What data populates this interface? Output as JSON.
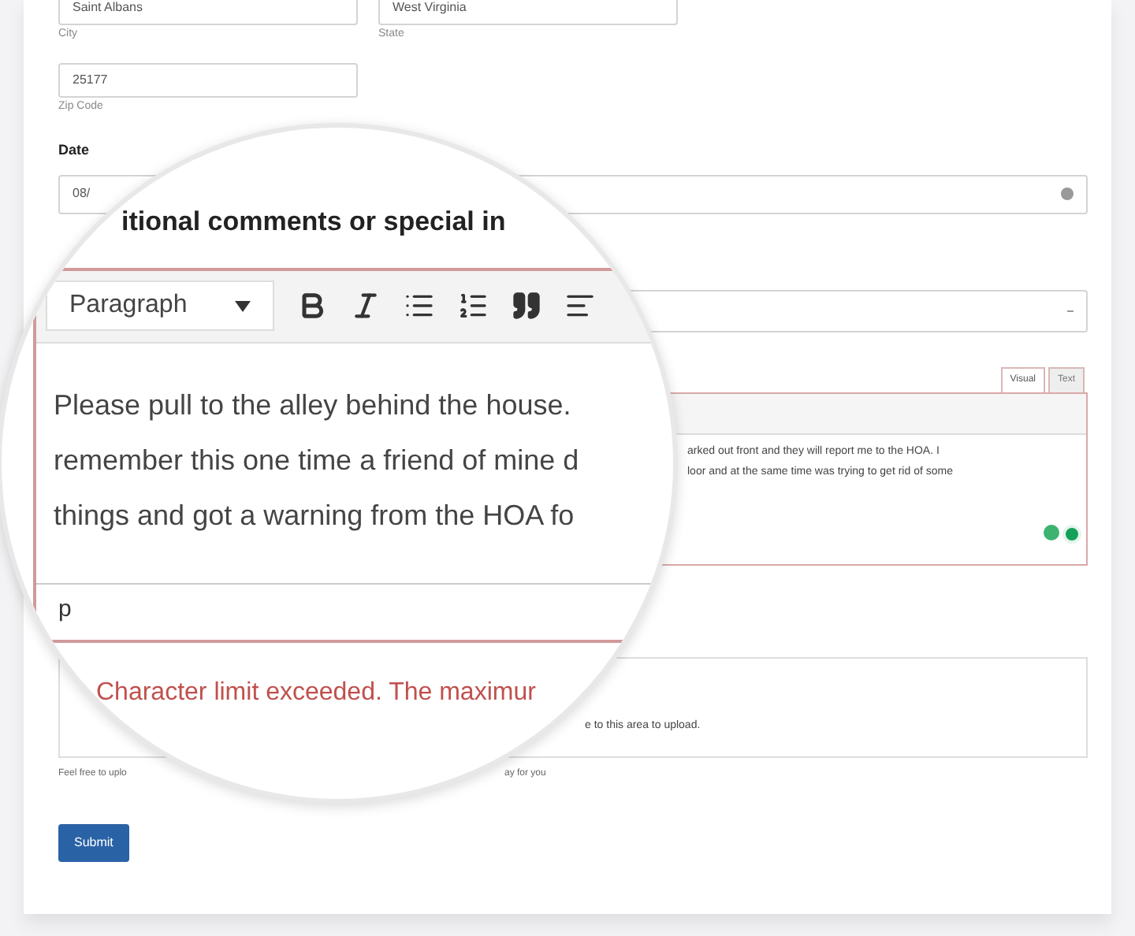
{
  "address": {
    "fields": [
      {
        "label": "City",
        "value": "Saint Albans"
      },
      {
        "label": "State",
        "value": "West Virginia"
      },
      {
        "label": "Zip Code",
        "value": "25177"
      }
    ]
  },
  "date": {
    "label": "Date",
    "value": "08/"
  },
  "editor": {
    "tabs": [
      {
        "label": "Visual",
        "selected": true
      },
      {
        "label": "Text",
        "selected": false
      }
    ],
    "lines": [
      "arked out front and they will report me to the HOA. I",
      "loor and at the same time was trying to get rid of some"
    ]
  },
  "upload": {
    "text": "e to this area to upload.",
    "help": [
      "Feel free to uplo",
      "ay for you"
    ]
  },
  "submit": "Submit",
  "magnifier": {
    "heading": "itional comments or special in",
    "format": "Paragraph",
    "lines": [
      "Please pull to the alley behind the house.",
      "remember this one time a friend of mine d",
      "things and got a warning from the HOA fo"
    ],
    "path": "p",
    "error": "Character limit exceeded. The maximur"
  }
}
